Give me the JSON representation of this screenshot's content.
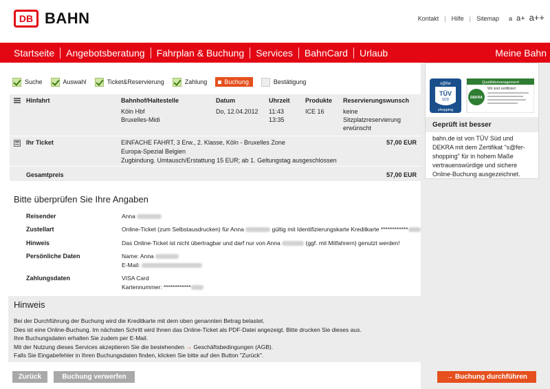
{
  "brand": {
    "logo_mark": "DB",
    "logo_text": "BAHN",
    "color": "#e30613",
    "accent": "#e5501e"
  },
  "util": {
    "links": [
      "Kontakt",
      "Hilfe",
      "Sitemap"
    ],
    "font_small": "a",
    "font_medium": "a+",
    "font_large": "a++"
  },
  "nav": {
    "items": [
      "Startseite",
      "Angebotsberatung",
      "Fahrplan & Buchung",
      "Services",
      "BahnCard",
      "Urlaub"
    ],
    "right": "Meine Bahn"
  },
  "steps": [
    {
      "label": "Suche",
      "state": "done"
    },
    {
      "label": "Auswahl",
      "state": "done"
    },
    {
      "label": "Ticket&Reservierung",
      "state": "done"
    },
    {
      "label": "Zahlung",
      "state": "done"
    },
    {
      "label": "Buchung",
      "state": "active"
    },
    {
      "label": "Bestätigung",
      "state": "pending"
    }
  ],
  "journey": {
    "label": "Hinfahrt",
    "headers": {
      "station": "Bahnhof/Haltestelle",
      "date": "Datum",
      "time": "Uhrzeit",
      "product": "Produkte",
      "reservation": "Reservierungswunsch"
    },
    "stations": [
      "Köln Hbf",
      "Bruxelles-Midi"
    ],
    "date": "Do, 12.04.2012",
    "times": [
      "11:43",
      "13:35"
    ],
    "product": "ICE 16",
    "reservation": [
      "keine",
      "Sitzplatzreservierung",
      "erwünscht"
    ]
  },
  "ticket": {
    "label": "Ihr Ticket",
    "lines": [
      "EINFACHE FAHRT, 3 Erw., 2. Klasse, Köln - Bruxelles Zone",
      "Europa-Spezial Belgien",
      "Zugbindung. Umtausch/Erstattung 15 EUR; ab 1. Geltungstag ausgeschlossen"
    ],
    "price": "57,00 EUR"
  },
  "total": {
    "label": "Gesamtpreis",
    "price": "57,00 EUR"
  },
  "review": {
    "title": "Bitte überprüfen Sie Ihre Angaben",
    "reisender_label": "Reisender",
    "reisender_value": "Anna",
    "zustellart_label": "Zustellart",
    "zustellart_a": "Online-Ticket (zum Selbstausdrucken) für Anna",
    "zustellart_b": "gültig mit Identifizierungskarte Kreditkarte ************",
    "hinweis_label": "Hinweis",
    "hinweis_a": "Das Online-Ticket ist nicht übertragbar und darf nur von Anna",
    "hinweis_b": "(ggf. mit Mitfahrern) genutzt werden!",
    "personal_label": "Persönliche Daten",
    "name_line": "Name: Anna",
    "email_line": "E-Mail:",
    "payment_label": "Zahlungsdaten",
    "card_type": "VISA Card",
    "card_number": "Kartennummer: ************"
  },
  "notice": {
    "title": "Hinweis",
    "lines": [
      "Bei der Durchführung der Buchung wird die Kreditkarte mit dem oben genannten Betrag belastet.",
      "Dies ist eine Online-Buchung. Im nächsten Schritt wird Ihnen das Online-Ticket als PDF-Datei angezeigt. Bitte drucken Sie dieses aus.",
      "Ihre Buchungsdaten erhalten Sie zudem per E-Mail."
    ],
    "agb_prefix": "Mit der Nutzung dieses Services akzeptieren Sie die bestehenden",
    "agb_link": "Geschäftsbedingungen (AGB).",
    "last_line": "Falls Sie Eingabefehler in Ihren Buchungsdaten finden, klicken Sie bitte auf den Button \"Zurück\"."
  },
  "buttons": {
    "back": "Zurück",
    "discard": "Buchung verwerfen",
    "submit": "Buchung durchführen"
  },
  "cert": {
    "tuv_top": "s@fer",
    "tuv_mid": "TÜV",
    "tuv_sub": "SÜD",
    "tuv_bottom": "shopping",
    "dekra_head": "Qualitätsmanagement",
    "dekra_line1": "Wir sind zertifiziert",
    "dekra_name": "DEKRA",
    "title": "Geprüft ist besser",
    "text": "bahn.de ist von TÜV Süd und DEKRA mit dem Zertifikat \"s@fer-shopping\" für in hohem Maße vertrauenswürdige und sichere Online-Buchung ausgezeichnet."
  }
}
